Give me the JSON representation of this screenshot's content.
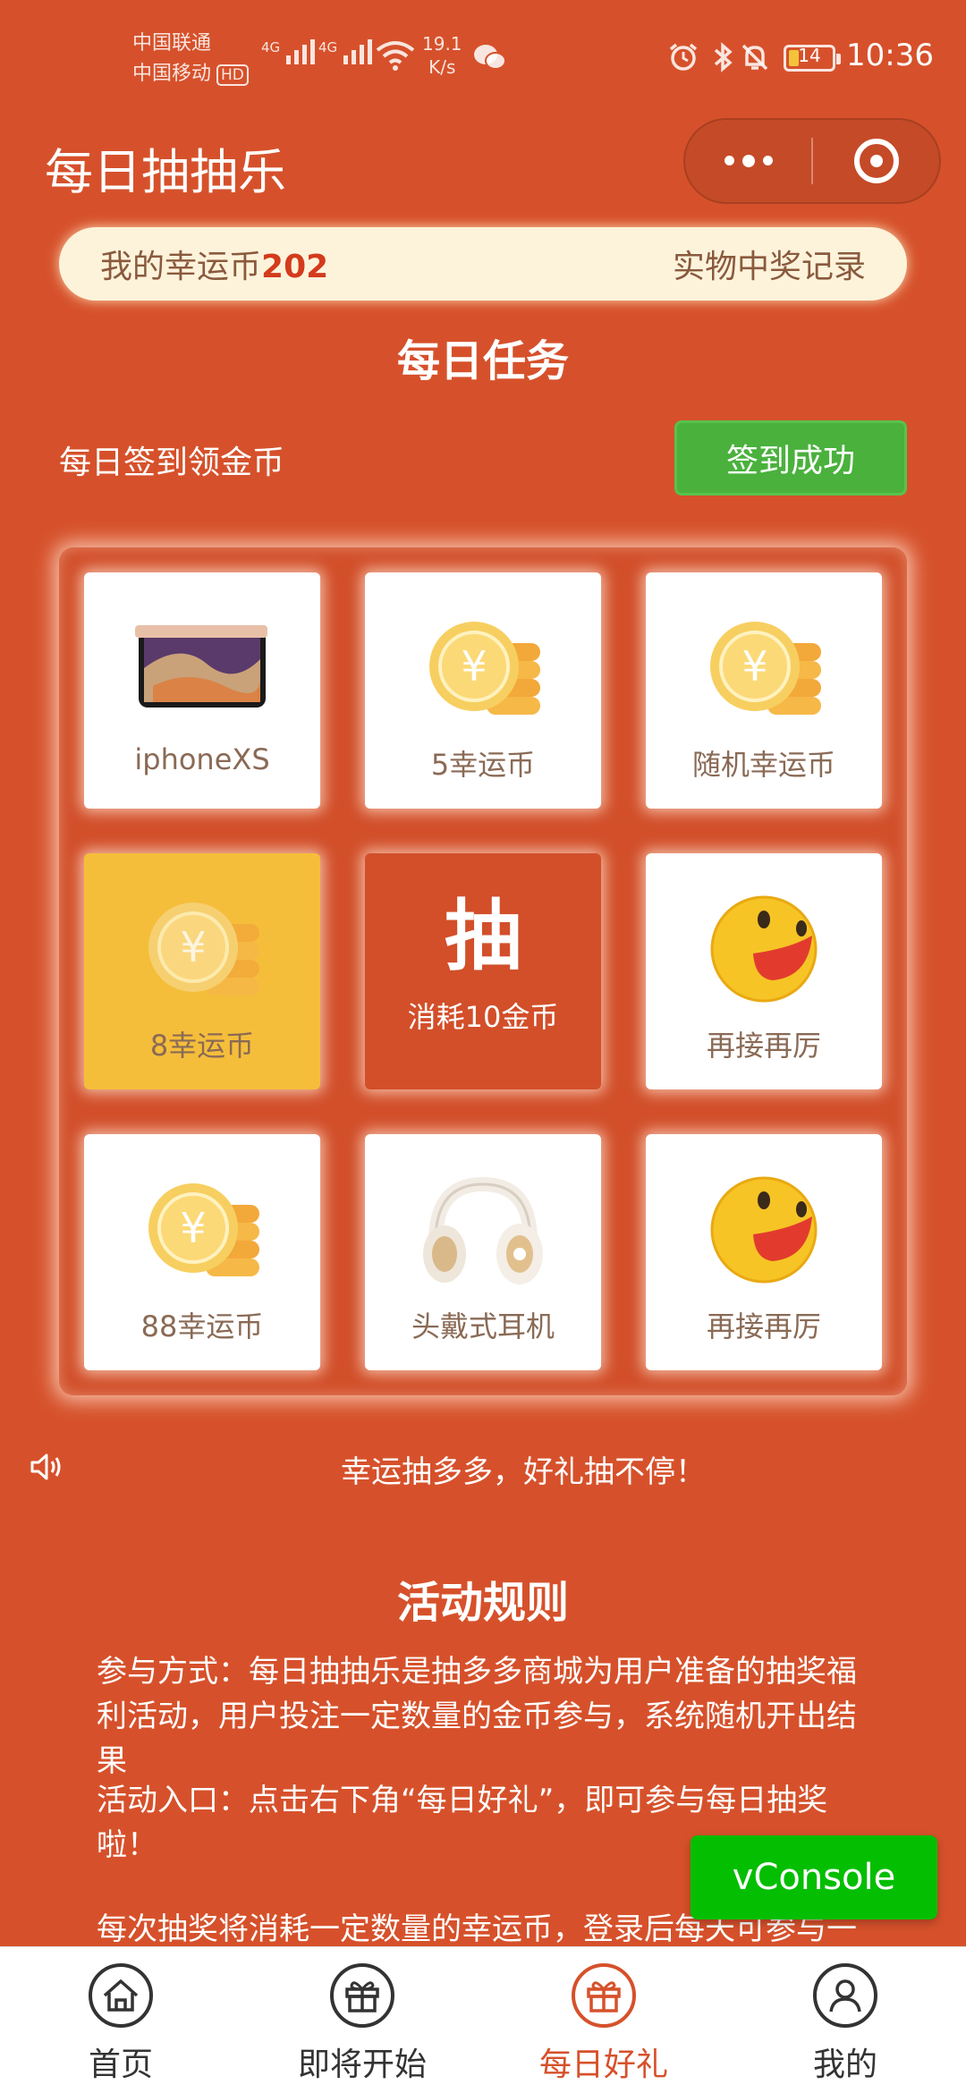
{
  "status_bar": {
    "carrier_1": "中国联通",
    "carrier_2": "中国移动",
    "hd": "HD",
    "network_1": "4G",
    "network_2": "4G",
    "speed_value": "19.1",
    "speed_unit": "K/s",
    "battery": "14",
    "time": "10:36"
  },
  "title_bar": {
    "title": "每日抽抽乐"
  },
  "coin_bar": {
    "label": "我的幸运币",
    "count": "202",
    "records_link": "实物中奖记录"
  },
  "tasks": {
    "title": "每日任务",
    "signin_label": "每日签到领金币",
    "signin_button": "签到成功"
  },
  "grid": {
    "cells": [
      {
        "label": "iphoneXS",
        "icon": "phone-icon"
      },
      {
        "label": "5幸运币",
        "icon": "coin-icon"
      },
      {
        "label": "随机幸运币",
        "icon": "coin-icon"
      },
      {
        "label": "8幸运币",
        "icon": "coin-icon",
        "highlighted": true
      },
      {
        "label": "抽",
        "sub": "消耗10金币",
        "icon": "draw-button"
      },
      {
        "label": "再接再厉",
        "icon": "smiley-icon"
      },
      {
        "label": "88幸运币",
        "icon": "coin-icon"
      },
      {
        "label": "头戴式耳机",
        "icon": "headphones-icon"
      },
      {
        "label": "再接再厉",
        "icon": "smiley-icon"
      }
    ]
  },
  "marquee": {
    "text": "幸运抽多多，好礼抽不停！"
  },
  "rules": {
    "title": "活动规则",
    "p1": "参与方式：每日抽抽乐是抽多多商城为用户准备的抽奖福利活动，用户投注一定数量的金币参与，系统随机开出结果",
    "p2": "活动入口：点击右下角“每日好礼”，即可参与每日抽奖啦！",
    "p3": "每次抽奖将消耗一定数量的幸运币，登录后每天可参与一定"
  },
  "vconsole": {
    "label": "vConsole"
  },
  "tabbar": {
    "tabs": [
      {
        "label": "首页"
      },
      {
        "label": "即将开始"
      },
      {
        "label": "每日好礼",
        "active": true
      },
      {
        "label": "我的"
      }
    ]
  },
  "colors": {
    "background": "#d6512b",
    "accent_green": "#4ab13d",
    "highlight_yellow": "#f5be3a",
    "coin_bar": "#fdf3db"
  }
}
